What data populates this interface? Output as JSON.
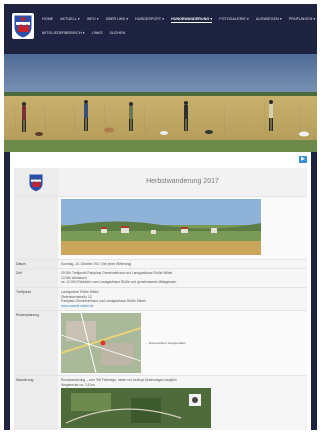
{
  "nav": {
    "row1": [
      {
        "label": "HOME"
      },
      {
        "label": "AKTUELL ▾"
      },
      {
        "label": "INFO ▾"
      },
      {
        "label": "ÜBER UNS ▾"
      },
      {
        "label": "HUNDESPORT ▾"
      },
      {
        "label": "HUNDEWANDERUNG ▾",
        "active": true
      },
      {
        "label": "FOTOGALERIE ▾"
      },
      {
        "label": "AUSWIEGEN ▾"
      },
      {
        "label": "PRÜFUNGEN ▾"
      }
    ],
    "row2": [
      {
        "label": "MITGLIEDERBEREICH ▾"
      },
      {
        "label": "LINKS"
      },
      {
        "label": "SUCHEN"
      }
    ]
  },
  "page": {
    "title": "Herbstwanderung 2017",
    "share_icon": "play-icon"
  },
  "details": {
    "datum_label": "Datum",
    "datum_value": "Sonntag, 15. Oktober 2017 (bei jeder Witterung)",
    "zeit_label": "Zeit",
    "zeit_lines": [
      "09:30h Treffpunkt Parkplatz Gemeindehaus und Landgasthaus Rößle Wildel",
      "10:00h Abmarsch",
      "ca. 12:30h Rückkehr zum Landgasthaus Rößle und gemeinsames Mittagessen"
    ],
    "treffpunkt_label": "Treffpunkt",
    "treffpunkt_lines": [
      "Landgasthof Rößle Wildel",
      "Dietenbachstraße 13",
      "Parkplatz Gemeindehaus und Landgasthaus Rößle Wildel"
    ],
    "treffpunkt_link": "www.roessle-wildel.de",
    "routenplanung_label": "Routenplanung",
    "routenplanung_note": "← Routenplaner Google-Maps",
    "wanderung_label": "Wanderung",
    "wanderung_lines": [
      "Rundwanderung – zum Teil Feldwege, daher nur bedingt Kinderwagen-tauglich.",
      "Wegstrecke ca. 7-8 km"
    ]
  }
}
